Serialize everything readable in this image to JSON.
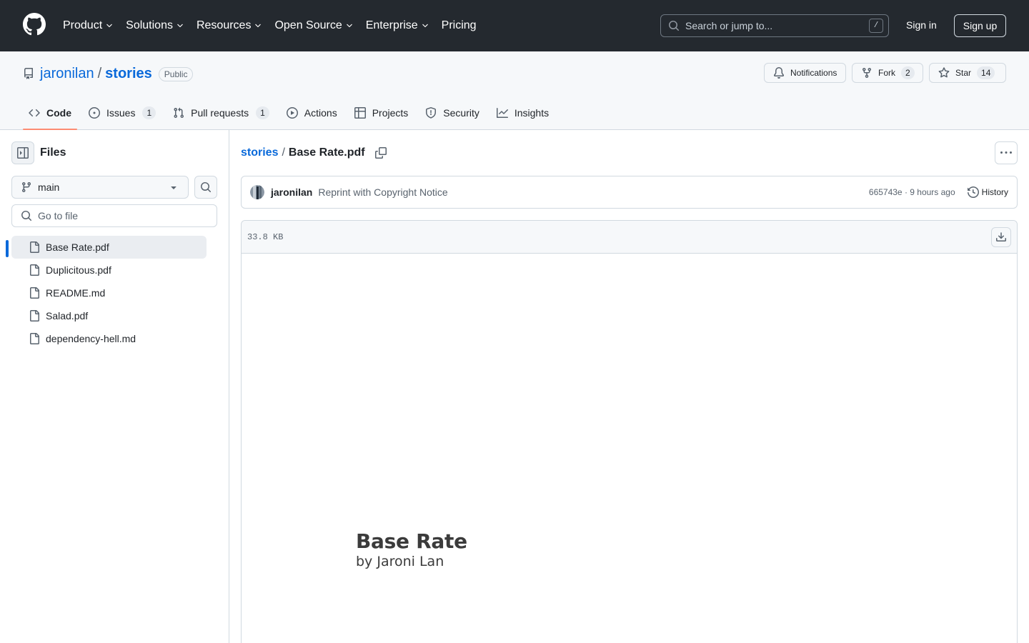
{
  "header": {
    "nav": [
      {
        "label": "Product"
      },
      {
        "label": "Solutions"
      },
      {
        "label": "Resources"
      },
      {
        "label": "Open Source"
      },
      {
        "label": "Enterprise"
      },
      {
        "label": "Pricing"
      }
    ],
    "search_placeholder": "Search or jump to...",
    "search_shortcut": "/",
    "sign_in": "Sign in",
    "sign_up": "Sign up"
  },
  "repo": {
    "owner": "jaronilan",
    "separator": "/",
    "name": "stories",
    "visibility": "Public",
    "notifications_label": "Notifications",
    "fork_label": "Fork",
    "fork_count": "2",
    "star_label": "Star",
    "star_count": "14",
    "tabs": [
      {
        "label": "Code",
        "icon": "code-icon",
        "active": true
      },
      {
        "label": "Issues",
        "icon": "issue-icon",
        "count": "1"
      },
      {
        "label": "Pull requests",
        "icon": "pull-request-icon",
        "count": "1"
      },
      {
        "label": "Actions",
        "icon": "play-icon"
      },
      {
        "label": "Projects",
        "icon": "table-icon"
      },
      {
        "label": "Security",
        "icon": "shield-icon"
      },
      {
        "label": "Insights",
        "icon": "graph-icon"
      }
    ]
  },
  "sidebar": {
    "title": "Files",
    "branch": "main",
    "goto_placeholder": "Go to file",
    "files": [
      {
        "name": "Base Rate.pdf",
        "active": true
      },
      {
        "name": "Duplicitous.pdf"
      },
      {
        "name": "README.md"
      },
      {
        "name": "Salad.pdf"
      },
      {
        "name": "dependency-hell.md"
      }
    ]
  },
  "main": {
    "breadcrumb_repo": "stories",
    "breadcrumb_sep": "/",
    "file_name": "Base Rate.pdf",
    "commit": {
      "author": "jaronilan",
      "message": "Reprint with Copyright Notice",
      "meta": "665743e · 9 hours ago",
      "history_label": "History"
    },
    "file_size": "33.8 KB",
    "pdf": {
      "title": "Base Rate",
      "byline": "by Jaroni Lan"
    }
  },
  "colors": {
    "header_bg": "#24292f",
    "link": "#0969da",
    "active_tab_underline": "#fd8c73",
    "border": "#d1d9e0"
  }
}
